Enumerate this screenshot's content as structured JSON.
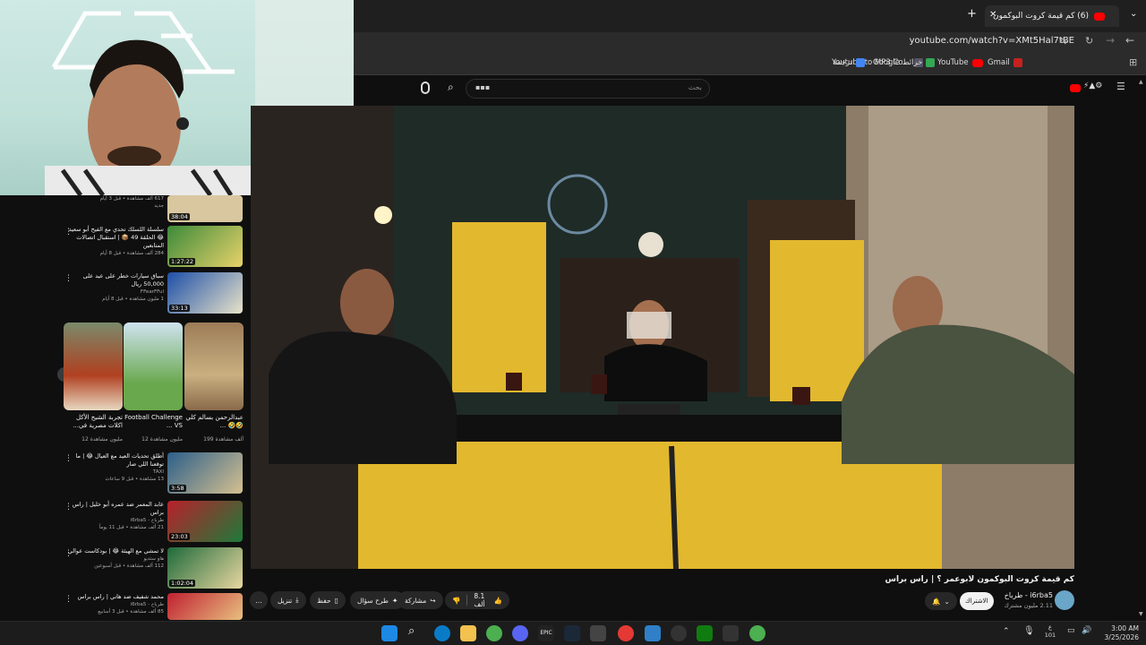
{
  "browser": {
    "tab_title": "(6) كم قيمة كروت البوكمون لابوع...",
    "new_tab": "+",
    "close": "✕",
    "url": "youtube.com/watch?v=XMt5Hal7tBE",
    "bookmarks": [
      "Youtube to MP3 Co...",
      "Gmail",
      "YouTube",
      "Google خرائط",
      "ترجمة"
    ]
  },
  "youtube": {
    "search_placeholder": "بحث",
    "search_value": "▪▪▪",
    "video": {
      "title": "كم قيمة كروت البوكمون لابوعمر ؟ | راس براس",
      "channel": "i6rba5 - طرباخ",
      "subscribers": "2.11 مليون مشترك",
      "subscribe_label": "الاشتراك",
      "likes": "8.1 ألف",
      "share": "مشاركة",
      "ask": "طرح سؤال",
      "save": "حفظ",
      "download": "تنزيل",
      "more": "…"
    },
    "sidebar_top_meta": [
      "617 ألف مشاهدة • قبل 3 أيام",
      "جديد"
    ],
    "sidebar_videos": [
      {
        "title": "سلسلة اللسلك تحدي مع الفيح أبو سعيد 😂 الحلقة 49 📦 | استقبال اتصالات المتابعين",
        "meta": "284 ألف مشاهدة • قبل 8 أيام",
        "duration": "1:27:22"
      },
      {
        "title": "سباق سيارات خطر على عيد على 50,000 ريال",
        "channel": "FFearFFul",
        "meta": "1 مليون مشاهدة • قبل 8 أيام",
        "duration": "33:13"
      },
      {
        "title": "أطلق تحديات العيد مع العيال 😂 | ما توقعنا اللي صار",
        "channel": "TAXI",
        "meta": "13 مشاهدة • قبل 9 ساعات",
        "duration": "3:58"
      },
      {
        "title": "عابد المعمر ضد عمره أبو خليل | راس براس",
        "channel": "طرباخ - i6rba5",
        "meta": "21 ألف مشاهدة • قبل 11 يوماً",
        "duration": "23:03"
      },
      {
        "title": "لا تمشي مع الهيئة 😂 | بودكاست عوالي",
        "channel": "هاو ستديو",
        "meta": "112 ألف مشاهدة • قبل أسبوعين",
        "duration": "1:02:04"
      },
      {
        "title": "محمد شفيف ضد هاني | راس براس",
        "channel": "طرباخ - i6rba5",
        "meta": "85 ألف مشاهدة • قبل 3 أسابيع",
        "duration": ""
      }
    ],
    "shorts": [
      {
        "title": "عبدالرحمن بسالم كلي 🤣🤣 ...",
        "meta": "199 ألف مشاهدة"
      },
      {
        "title": "Football Challenge VS ...",
        "meta": "12 مليون مشاهدة"
      },
      {
        "title": "تجربة الشيخ الأكل اكلات مصرية في...",
        "meta": "12 مليون مشاهدة"
      }
    ]
  },
  "taskbar": {
    "time": "3:00 AM",
    "date": "3/25/2026",
    "lang_top": "ع",
    "lang_bottom": "101"
  },
  "colors": {
    "accent": "#ff0000",
    "subscribe_bg": "#f1f1f1"
  }
}
